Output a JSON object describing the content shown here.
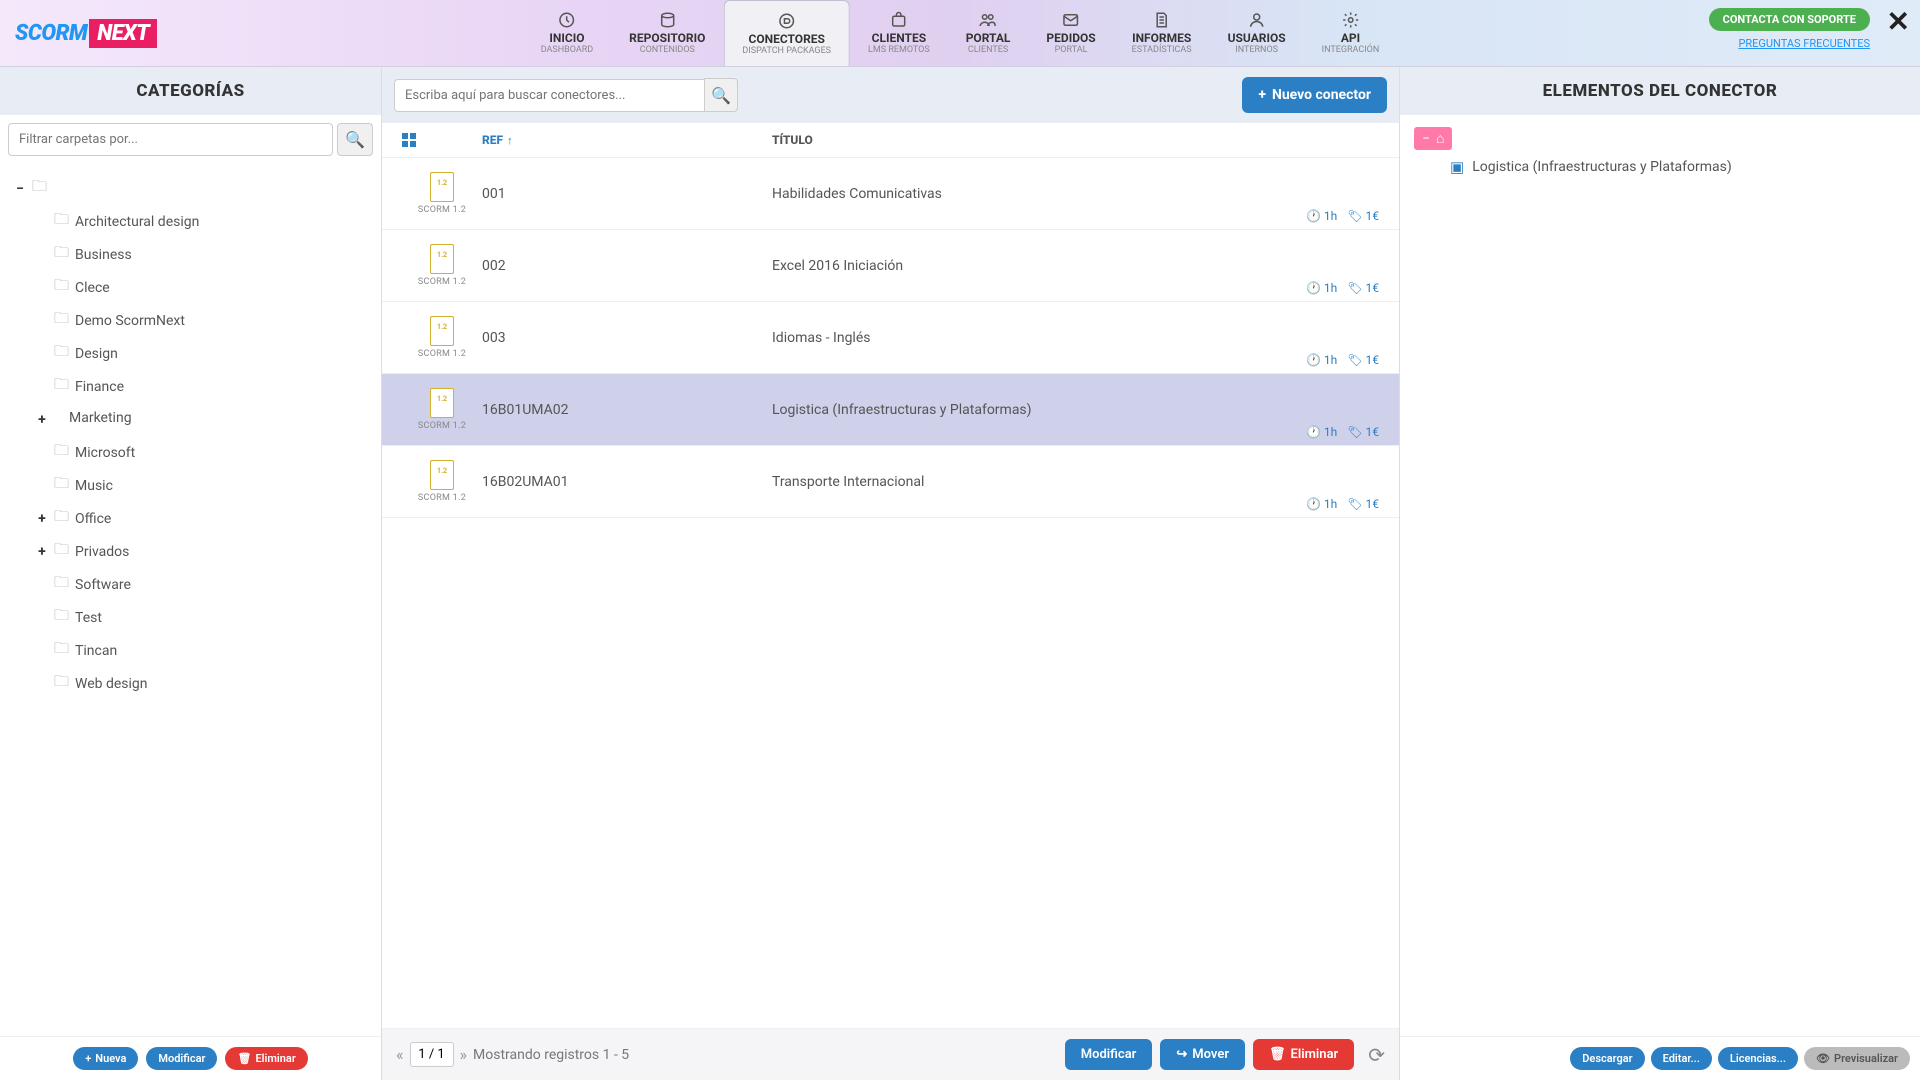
{
  "logo": {
    "part1": "SCORM",
    "part2": "NEXT"
  },
  "nav": [
    {
      "label": "INICIO",
      "sub": "DASHBOARD"
    },
    {
      "label": "REPOSITORIO",
      "sub": "CONTENIDOS"
    },
    {
      "label": "CONECTORES",
      "sub": "DISPATCH PACKAGES",
      "active": true
    },
    {
      "label": "CLIENTES",
      "sub": "LMS REMOTOS"
    },
    {
      "label": "PORTAL",
      "sub": "CLIENTES"
    },
    {
      "label": "PEDIDOS",
      "sub": "PORTAL"
    },
    {
      "label": "INFORMES",
      "sub": "ESTADÍSTICAS"
    },
    {
      "label": "USUARIOS",
      "sub": "INTERNOS"
    },
    {
      "label": "API",
      "sub": "INTEGRACIÓN"
    }
  ],
  "header": {
    "support": "CONTACTA CON SOPORTE",
    "faq": "PREGUNTAS FRECUENTES"
  },
  "left": {
    "title": "CATEGORÍAS",
    "filter_placeholder": "Filtrar carpetas por...",
    "tree": [
      {
        "label": "Architectural design"
      },
      {
        "label": "Business"
      },
      {
        "label": "Clece"
      },
      {
        "label": "Demo ScormNext"
      },
      {
        "label": "Design"
      },
      {
        "label": "Finance"
      },
      {
        "label": "Marketing",
        "expandable": true,
        "selected": true
      },
      {
        "label": "Microsoft"
      },
      {
        "label": "Music"
      },
      {
        "label": "Office",
        "expandable": true
      },
      {
        "label": "Privados",
        "expandable": true
      },
      {
        "label": "Software"
      },
      {
        "label": "Test"
      },
      {
        "label": "Tincan"
      },
      {
        "label": "Web design"
      }
    ],
    "footer": {
      "new": "Nueva",
      "edit": "Modificar",
      "delete": "Eliminar"
    }
  },
  "center": {
    "search_placeholder": "Escriba aquí para buscar conectores...",
    "new_btn": "Nuevo conector",
    "cols": {
      "ref": "REF",
      "title": "TÍTULO"
    },
    "file_sub": "SCORM 1.2",
    "rows": [
      {
        "ref": "001",
        "title": "Habilidades Comunicativas",
        "time": "1h",
        "price": "1€"
      },
      {
        "ref": "002",
        "title": "Excel 2016 Iniciación",
        "time": "1h",
        "price": "1€"
      },
      {
        "ref": "003",
        "title": "Idiomas - Inglés",
        "time": "1h",
        "price": "1€"
      },
      {
        "ref": "16B01UMA02",
        "title": "Logistica (Infraestructuras y Plataformas)",
        "time": "1h",
        "price": "1€",
        "selected": true
      },
      {
        "ref": "16B02UMA01",
        "title": "Transporte Internacional",
        "time": "1h",
        "price": "1€"
      }
    ],
    "pager": {
      "page": "1 / 1",
      "info": "Mostrando registros 1 - 5"
    },
    "actions": {
      "edit": "Modificar",
      "move": "Mover",
      "delete": "Eliminar"
    }
  },
  "right": {
    "title": "ELEMENTOS DEL CONECTOR",
    "child": "Logistica (Infraestructuras y Plataformas)",
    "footer": {
      "download": "Descargar",
      "edit": "Editar...",
      "lic": "Licencias...",
      "preview": "Previsualizar"
    }
  }
}
